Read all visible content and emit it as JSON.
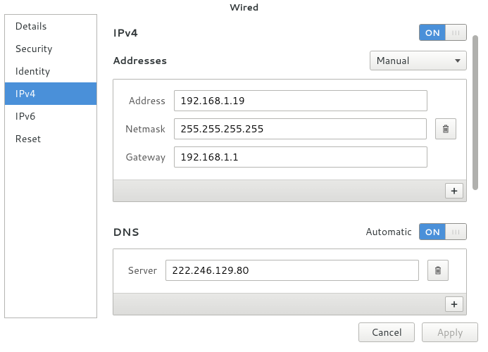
{
  "window": {
    "title": "Wired"
  },
  "sidebar": {
    "items": [
      {
        "label": "Details"
      },
      {
        "label": "Security"
      },
      {
        "label": "Identity"
      },
      {
        "label": "IPv4"
      },
      {
        "label": "IPv6"
      },
      {
        "label": "Reset"
      }
    ],
    "selected_index": 3
  },
  "ipv4": {
    "title": "IPv4",
    "toggle_label": "ON",
    "addresses_title": "Addresses",
    "addresses_mode": "Manual",
    "address_label": "Address",
    "netmask_label": "Netmask",
    "gateway_label": "Gateway",
    "address_value": "192.168.1.19",
    "netmask_value": "255.255.255.255",
    "gateway_value": "192.168.1.1"
  },
  "dns": {
    "title": "DNS",
    "automatic_label": "Automatic",
    "toggle_label": "ON",
    "server_label": "Server",
    "server_value": "222.246.129.80"
  },
  "buttons": {
    "cancel": "Cancel",
    "apply": "Apply",
    "add": "+"
  }
}
